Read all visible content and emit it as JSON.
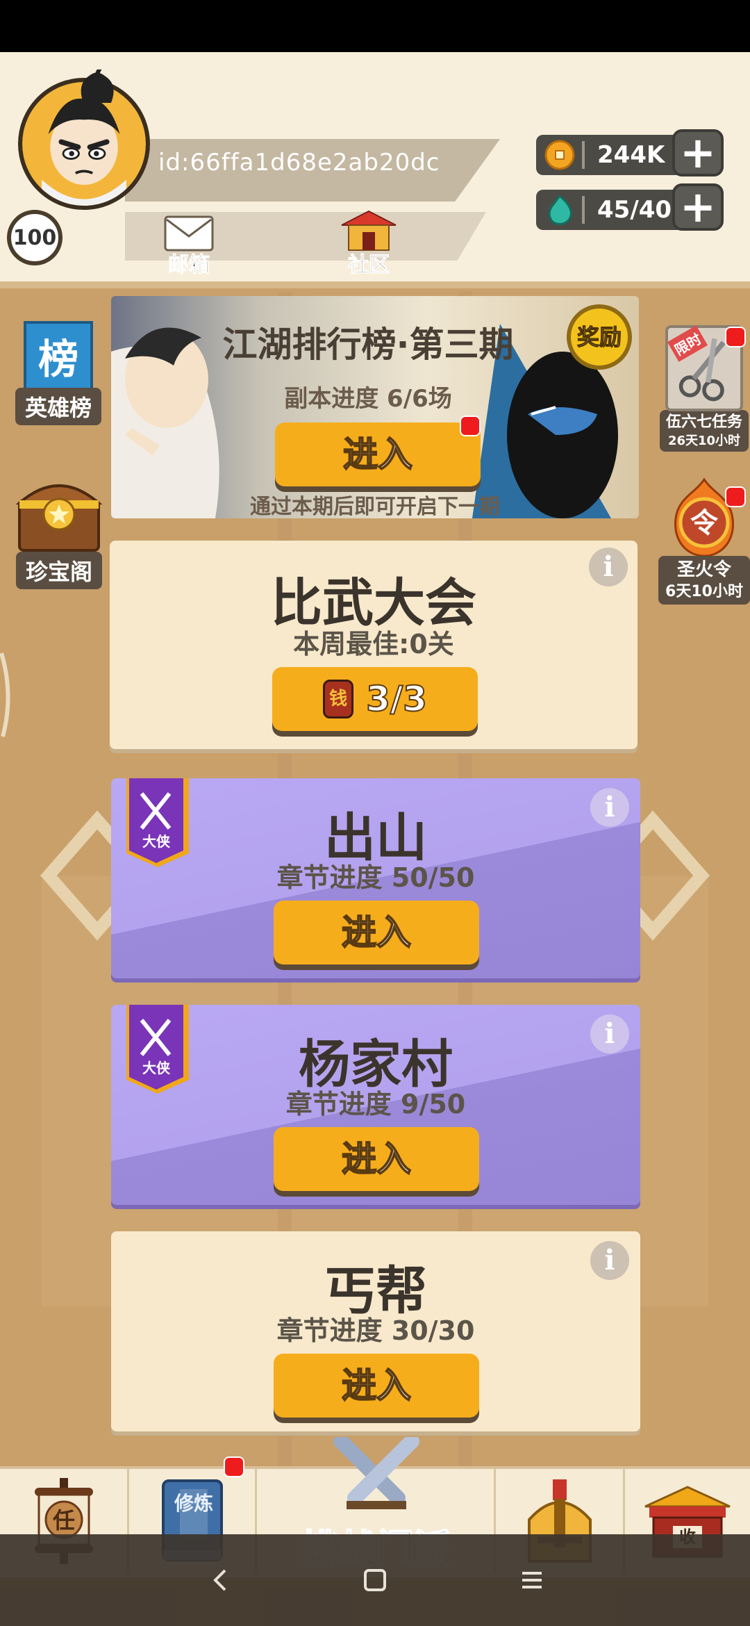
{
  "profile": {
    "id_text": "id:66ffa1d68e2ab20dc",
    "level": "100"
  },
  "header": {
    "mail_label": "邮箱",
    "community_label": "社区"
  },
  "currencies": {
    "coins": "244K",
    "stamina": "45/40"
  },
  "side_left": {
    "leaderboard_glyph": "榜",
    "leaderboard_label": "英雄榜",
    "treasure_label": "珍宝阁"
  },
  "side_right": {
    "task_tag": "限时",
    "task_label": "伍六七任务",
    "task_time": "26天10小时",
    "token_glyph": "令",
    "token_label": "圣火令",
    "token_time": "6天10小时"
  },
  "banner": {
    "title": "江湖排行榜·第三期",
    "progress": "副本进度 6/6场",
    "reward_label": "奖励",
    "enter_label": "进入",
    "hint": "通过本期后即可开启下一期"
  },
  "cards": [
    {
      "title": "比武大会",
      "subtitle": "本周最佳:0关",
      "ticket_glyph": "钱",
      "button": "3/3"
    },
    {
      "badge": "大侠",
      "title": "出山",
      "subtitle": "章节进度 50/50",
      "button": "进入"
    },
    {
      "badge": "大侠",
      "title": "杨家村",
      "subtitle": "章节进度 9/50",
      "button": "进入"
    },
    {
      "title": "丐帮",
      "subtitle": "章节进度 30/30",
      "button": "进入"
    }
  ],
  "info_glyph": "i",
  "bottom_nav": {
    "task_glyph": "任",
    "cultivate_glyph": "修炼",
    "challenge_label": "挑战门派",
    "shop_glyph": "收"
  },
  "colors": {
    "header_bg": "#f7eedb",
    "card_cream": "#f8e9cc",
    "card_purple": "#b3a2ee",
    "button_orange": "#f6ad1c",
    "badge_red": "#ee1c1c"
  }
}
